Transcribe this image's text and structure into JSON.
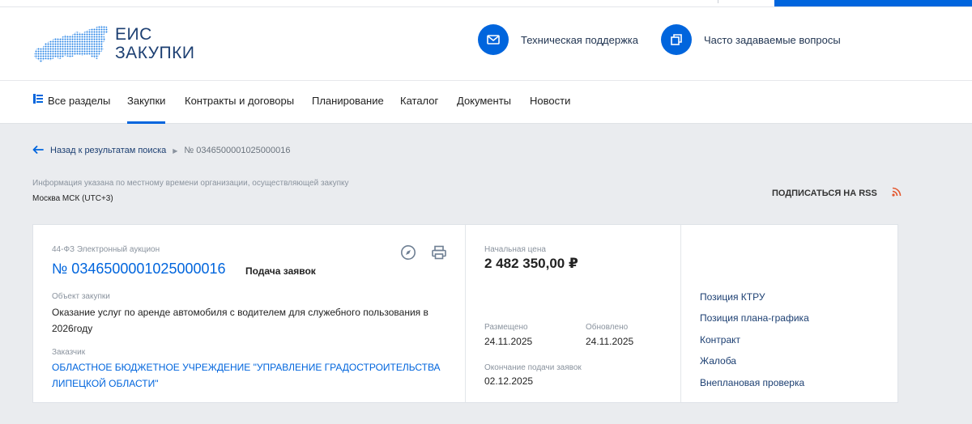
{
  "logo": {
    "line1": "ЕИС",
    "line2": "ЗАКУПКИ"
  },
  "header_links": [
    {
      "label": "Техническая поддержка",
      "icon": "mail-icon"
    },
    {
      "label": "Часто задаваемые вопросы",
      "icon": "copy-icon"
    }
  ],
  "nav": {
    "items": [
      {
        "label": "Все разделы",
        "icon": "sections-icon"
      },
      {
        "label": "Закупки",
        "active": true
      },
      {
        "label": "Контракты и договоры"
      },
      {
        "label": "Планирование"
      },
      {
        "label": "Каталог"
      },
      {
        "label": "Документы"
      },
      {
        "label": "Новости"
      }
    ]
  },
  "breadcrumb": {
    "back_label": "Назад к результатам поиска",
    "current": "№ 0346500001025000016"
  },
  "timezone": {
    "note": "Информация указана по местному времени организации, осуществляющей закупку",
    "zone": "Москва МСК (UTC+3)"
  },
  "rss": {
    "label": "ПОДПИСАТЬСЯ НА RSS"
  },
  "card": {
    "law": "44-ФЗ Электронный аукцион",
    "number": "№ 0346500001025000016",
    "status": "Подача заявок",
    "object_label": "Объект закупки",
    "object_text": "Оказание услуг по аренде автомобиля с водителем для служебного пользования в 2026году",
    "customer_label": "Заказчик",
    "customer_text": "ОБЛАСТНОЕ БЮДЖЕТНОЕ УЧРЕЖДЕНИЕ \"УПРАВЛЕНИЕ ГРАДОСТРОИТЕЛЬСТВА ЛИПЕЦКОЙ ОБЛАСТИ\"",
    "price_label": "Начальная цена",
    "price": "2 482 350,00 ₽",
    "posted_label": "Размещено",
    "posted": "24.11.2025",
    "updated_label": "Обновлено",
    "updated": "24.11.2025",
    "end_label": "Окончание подачи заявок",
    "end": "02.12.2025",
    "links": [
      "Позиция КТРУ",
      "Позиция плана-графика",
      "Контракт",
      "Жалоба",
      "Внеплановая проверка"
    ]
  },
  "colors": {
    "accent": "#0065dd",
    "dark_blue": "#1c3f72",
    "rss": "#e4572e",
    "background": "#eaecef"
  }
}
